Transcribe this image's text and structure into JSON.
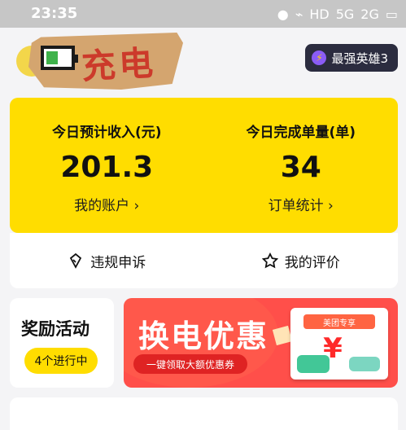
{
  "status_bar": {
    "time": "23:35",
    "network_hd": "HD",
    "signal_5g": "5G",
    "signal_2g": "2G"
  },
  "header": {
    "logo_text": "充电",
    "badge_label": "最强英雄3"
  },
  "today": {
    "income_title": "今日预计收入(元)",
    "income_value": "201.3",
    "account_link": "我的账户 ›",
    "orders_title": "今日完成单量(单)",
    "orders_value": "34",
    "orders_link": "订单统计 ›"
  },
  "actions": {
    "appeal": "违规申诉",
    "reviews": "我的评价"
  },
  "activity": {
    "title": "奖励活动",
    "running": "4个进行中"
  },
  "banner": {
    "title": "换电优惠",
    "cta": "一键领取大额优惠券",
    "voucher_label": "美团专享",
    "voucher_symbol": "¥"
  }
}
